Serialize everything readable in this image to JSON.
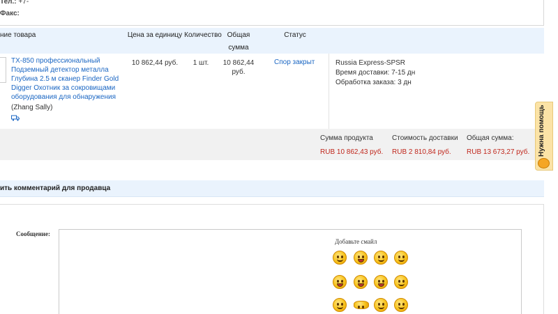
{
  "contact": {
    "phone_label": "Тел.:",
    "phone_value": "+7-",
    "fax_label": "Факс:"
  },
  "table": {
    "headers": {
      "product": "ние товара",
      "unit_price": "Цена за единицу",
      "quantity": "Количество",
      "total_line1": "Общая",
      "total_line2": "сумма",
      "status": "Статус"
    }
  },
  "item": {
    "title": "TX-850 профессиональный Подземный детектор металла Глубина 2.5 м сканер Finder Gold Digger Охотник за сокровищами оборудования для обнаружения",
    "seller": "(Zhang Sally)",
    "unit_price": "10 862,44 руб.",
    "quantity": "1 шт.",
    "total_line1": "10 862,44",
    "total_line2": "руб.",
    "status_link": "Спор закрыт",
    "shipping_method": "Russia Express-SPSR",
    "delivery_time": "Время доставки: 7-15 дн",
    "processing_time": "Обработка заказа: 3 дн"
  },
  "summary": {
    "product_label": "Сумма продукта",
    "product_value": "RUB 10 862,43 руб.",
    "shipping_label": "Стоимость доставки",
    "shipping_value": "RUB 2 810,84 руб.",
    "total_label": "Общая сумма:",
    "total_value": "RUB 13 673,27 руб."
  },
  "comment": {
    "header": "ить комментарий для продавца",
    "message_label": "Сообщение:",
    "smileys_title": "Добавьте смайл"
  },
  "help": {
    "label": "Нужна помощь"
  },
  "colors": {
    "link": "#1a66c3",
    "price_red": "#c0271c",
    "header_bg": "#eaf3fd",
    "help_bg": "#fbe3a6"
  }
}
